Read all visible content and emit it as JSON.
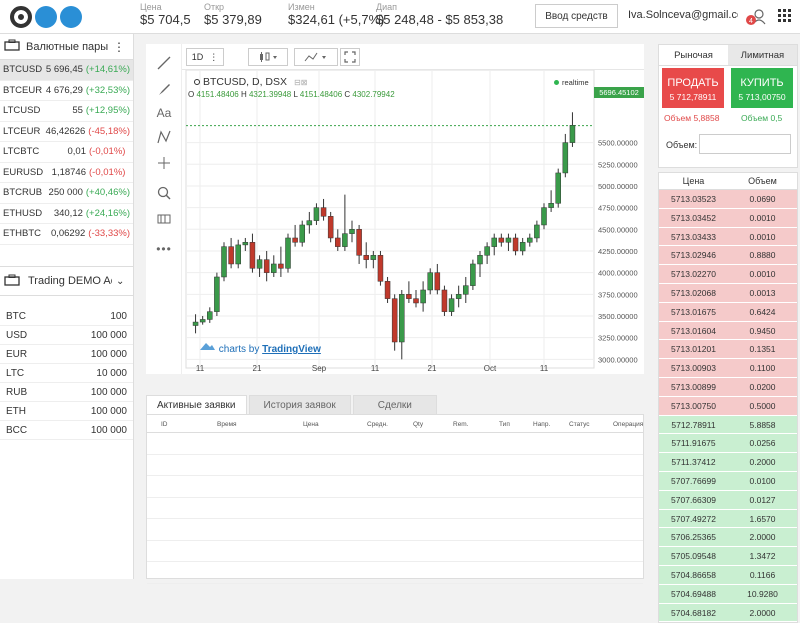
{
  "header": {
    "stats": [
      {
        "label": "Цена",
        "value": "$5 704,5"
      },
      {
        "label": "Откр",
        "value": "$5 379,89"
      },
      {
        "label": "Измен",
        "value": "$324,61 (+5,7%)"
      },
      {
        "label": "Диап",
        "value": "$5 248,48 - $5 853,38"
      }
    ],
    "deposit_label": "Ввод средств",
    "user_email": "Iva.Solnceva@gmail.com",
    "colors": {
      "logo1": "#333333",
      "logo2": "#2a8fd6",
      "logo3": "#2a8fd6"
    }
  },
  "left": {
    "pairs_title": "Валютные пары",
    "pairs": [
      {
        "name": "BTCUSD",
        "price": "5 696,45",
        "change": "(+14,61%)",
        "dir": "pos"
      },
      {
        "name": "BTCEUR",
        "price": "4 676,29",
        "change": "(+32,53%)",
        "dir": "pos"
      },
      {
        "name": "LTCUSD",
        "price": "55",
        "change": "(+12,95%)",
        "dir": "pos"
      },
      {
        "name": "LTCEUR",
        "price": "46,42626",
        "change": "(-45,18%)",
        "dir": "neg"
      },
      {
        "name": "LTCBTC",
        "price": "0,01",
        "change": "(-0,01%)",
        "dir": "neg"
      },
      {
        "name": "EURUSD",
        "price": "1,18746",
        "change": "(-0,01%)",
        "dir": "neg"
      },
      {
        "name": "BTCRUB",
        "price": "250 000",
        "change": "(+40,46%)",
        "dir": "pos"
      },
      {
        "name": "ETHUSD",
        "price": "340,12",
        "change": "(+24,16%)",
        "dir": "pos"
      },
      {
        "name": "ETHBTC",
        "price": "0,06292",
        "change": "(-33,33%)",
        "dir": "neg"
      }
    ],
    "account_title": "Trading DEMO Accoun",
    "balances": [
      {
        "cur": "BTC",
        "val": "100"
      },
      {
        "cur": "USD",
        "val": "100 000"
      },
      {
        "cur": "EUR",
        "val": "100 000"
      },
      {
        "cur": "LTC",
        "val": "10 000"
      },
      {
        "cur": "RUB",
        "val": "100 000"
      },
      {
        "cur": "ETH",
        "val": "100 000"
      },
      {
        "cur": "BCC",
        "val": "100 000"
      }
    ]
  },
  "chart": {
    "interval": "1D",
    "symbol_line": "BTCUSD, D, DSX",
    "ohlc": {
      "o_label": "O",
      "o": "4151.48406",
      "h_label": "H",
      "h": "4321.39948",
      "l_label": "L",
      "l": "4151.48406",
      "c_label": "C",
      "c": "4302.79942"
    },
    "realtime_label": "realtime",
    "last_price": "5696.45102",
    "watermark_prefix": "charts by",
    "watermark_brand": "TradingView",
    "yticks": [
      "5500.00000",
      "5250.00000",
      "5000.00000",
      "4750.00000",
      "4500.00000",
      "4250.00000",
      "4000.00000",
      "3750.00000",
      "3500.00000",
      "3250.00000",
      "3000.00000"
    ],
    "xticks": [
      "11",
      "21",
      "Sep",
      "11",
      "21",
      "Oct",
      "11"
    ],
    "chart_data": {
      "type": "candlestick",
      "ylim": [
        2900,
        5830
      ],
      "series": [
        {
          "o": 3390,
          "h": 3520,
          "l": 3300,
          "c": 3430
        },
        {
          "o": 3430,
          "h": 3500,
          "l": 3400,
          "c": 3460
        },
        {
          "o": 3460,
          "h": 3600,
          "l": 3420,
          "c": 3550
        },
        {
          "o": 3550,
          "h": 4000,
          "l": 3500,
          "c": 3950
        },
        {
          "o": 3950,
          "h": 4350,
          "l": 3900,
          "c": 4300
        },
        {
          "o": 4300,
          "h": 4400,
          "l": 4050,
          "c": 4100
        },
        {
          "o": 4100,
          "h": 4380,
          "l": 4050,
          "c": 4320
        },
        {
          "o": 4320,
          "h": 4400,
          "l": 4250,
          "c": 4350
        },
        {
          "o": 4350,
          "h": 4450,
          "l": 4000,
          "c": 4050
        },
        {
          "o": 4050,
          "h": 4200,
          "l": 3950,
          "c": 4150
        },
        {
          "o": 4150,
          "h": 4250,
          "l": 3900,
          "c": 4000
        },
        {
          "o": 4000,
          "h": 4200,
          "l": 3950,
          "c": 4100
        },
        {
          "o": 4100,
          "h": 4300,
          "l": 3950,
          "c": 4050
        },
        {
          "o": 4050,
          "h": 4450,
          "l": 4000,
          "c": 4400
        },
        {
          "o": 4400,
          "h": 4550,
          "l": 4300,
          "c": 4350
        },
        {
          "o": 4350,
          "h": 4600,
          "l": 4300,
          "c": 4550
        },
        {
          "o": 4550,
          "h": 4700,
          "l": 4450,
          "c": 4600
        },
        {
          "o": 4600,
          "h": 4800,
          "l": 4550,
          "c": 4750
        },
        {
          "o": 4750,
          "h": 4850,
          "l": 4600,
          "c": 4650
        },
        {
          "o": 4650,
          "h": 4700,
          "l": 4350,
          "c": 4400
        },
        {
          "o": 4400,
          "h": 4500,
          "l": 4250,
          "c": 4300
        },
        {
          "o": 4300,
          "h": 4900,
          "l": 4250,
          "c": 4450
        },
        {
          "o": 4450,
          "h": 4600,
          "l": 4350,
          "c": 4500
        },
        {
          "o": 4500,
          "h": 4550,
          "l": 4100,
          "c": 4200
        },
        {
          "o": 4200,
          "h": 4350,
          "l": 4050,
          "c": 4150
        },
        {
          "o": 4150,
          "h": 4250,
          "l": 4050,
          "c": 4200
        },
        {
          "o": 4200,
          "h": 4250,
          "l": 3850,
          "c": 3900
        },
        {
          "o": 3900,
          "h": 3950,
          "l": 3650,
          "c": 3700
        },
        {
          "o": 3700,
          "h": 3750,
          "l": 3100,
          "c": 3200
        },
        {
          "o": 3200,
          "h": 3800,
          "l": 3000,
          "c": 3750
        },
        {
          "o": 3750,
          "h": 3900,
          "l": 3650,
          "c": 3700
        },
        {
          "o": 3700,
          "h": 3800,
          "l": 3600,
          "c": 3650
        },
        {
          "o": 3650,
          "h": 3900,
          "l": 3550,
          "c": 3800
        },
        {
          "o": 3800,
          "h": 4050,
          "l": 3750,
          "c": 4000
        },
        {
          "o": 4000,
          "h": 4100,
          "l": 3750,
          "c": 3800
        },
        {
          "o": 3800,
          "h": 3850,
          "l": 3500,
          "c": 3550
        },
        {
          "o": 3550,
          "h": 3750,
          "l": 3500,
          "c": 3700
        },
        {
          "o": 3700,
          "h": 3850,
          "l": 3600,
          "c": 3750
        },
        {
          "o": 3750,
          "h": 3950,
          "l": 3650,
          "c": 3850
        },
        {
          "o": 3850,
          "h": 4150,
          "l": 3800,
          "c": 4100
        },
        {
          "o": 4100,
          "h": 4250,
          "l": 3950,
          "c": 4200
        },
        {
          "o": 4200,
          "h": 4350,
          "l": 4100,
          "c": 4300
        },
        {
          "o": 4300,
          "h": 4450,
          "l": 4200,
          "c": 4400
        },
        {
          "o": 4400,
          "h": 4450,
          "l": 4300,
          "c": 4350
        },
        {
          "o": 4350,
          "h": 4450,
          "l": 4250,
          "c": 4400
        },
        {
          "o": 4400,
          "h": 4450,
          "l": 4200,
          "c": 4250
        },
        {
          "o": 4250,
          "h": 4400,
          "l": 4200,
          "c": 4350
        },
        {
          "o": 4350,
          "h": 4450,
          "l": 4300,
          "c": 4400
        },
        {
          "o": 4400,
          "h": 4600,
          "l": 4350,
          "c": 4550
        },
        {
          "o": 4550,
          "h": 4800,
          "l": 4500,
          "c": 4750
        },
        {
          "o": 4750,
          "h": 4950,
          "l": 4700,
          "c": 4800
        },
        {
          "o": 4800,
          "h": 5200,
          "l": 4750,
          "c": 5150
        },
        {
          "o": 5150,
          "h": 5600,
          "l": 5100,
          "c": 5500
        },
        {
          "o": 5500,
          "h": 5850,
          "l": 5450,
          "c": 5700
        }
      ]
    }
  },
  "right": {
    "tab_market": "Рыночая",
    "tab_limit": "Лимитная",
    "sell_label": "ПРОДАТЬ",
    "sell_price": "5 712,78911",
    "buy_label": "КУПИТЬ",
    "buy_price": "5 713,00750",
    "sell_volume": "Объем 5,8858",
    "buy_volume": "Объем 0,5",
    "volume_label": "Объем:",
    "book_price_header": "Цена",
    "book_volume_header": "Объем",
    "asks": [
      {
        "p": "5713.03523",
        "v": "0.0690"
      },
      {
        "p": "5713.03452",
        "v": "0.0010"
      },
      {
        "p": "5713.03433",
        "v": "0.0010"
      },
      {
        "p": "5713.02946",
        "v": "0.8880"
      },
      {
        "p": "5713.02270",
        "v": "0.0010"
      },
      {
        "p": "5713.02068",
        "v": "0.0013"
      },
      {
        "p": "5713.01675",
        "v": "0.6424"
      },
      {
        "p": "5713.01604",
        "v": "0.9450"
      },
      {
        "p": "5713.01201",
        "v": "0.1351"
      },
      {
        "p": "5713.00903",
        "v": "0.1100"
      },
      {
        "p": "5713.00899",
        "v": "0.0200"
      },
      {
        "p": "5713.00750",
        "v": "0.5000"
      }
    ],
    "bids": [
      {
        "p": "5712.78911",
        "v": "5.8858"
      },
      {
        "p": "5711.91675",
        "v": "0.0256"
      },
      {
        "p": "5711.37412",
        "v": "0.2000"
      },
      {
        "p": "5707.76699",
        "v": "0.0100"
      },
      {
        "p": "5707.66309",
        "v": "0.0127"
      },
      {
        "p": "5707.49272",
        "v": "1.6570"
      },
      {
        "p": "5706.25365",
        "v": "2.0000"
      },
      {
        "p": "5705.09548",
        "v": "1.3472"
      },
      {
        "p": "5704.86658",
        "v": "0.1166"
      },
      {
        "p": "5704.69488",
        "v": "10.9280"
      },
      {
        "p": "5704.68182",
        "v": "2.0000"
      }
    ]
  },
  "orders": {
    "tabs": [
      "Активные заявки",
      "История заявок",
      "Сделки"
    ],
    "columns": [
      "ID",
      "Время",
      "Цена",
      "Средн.",
      "Qty",
      "Rem.",
      "Тип",
      "Напр.",
      "Статус",
      "Операция"
    ]
  }
}
